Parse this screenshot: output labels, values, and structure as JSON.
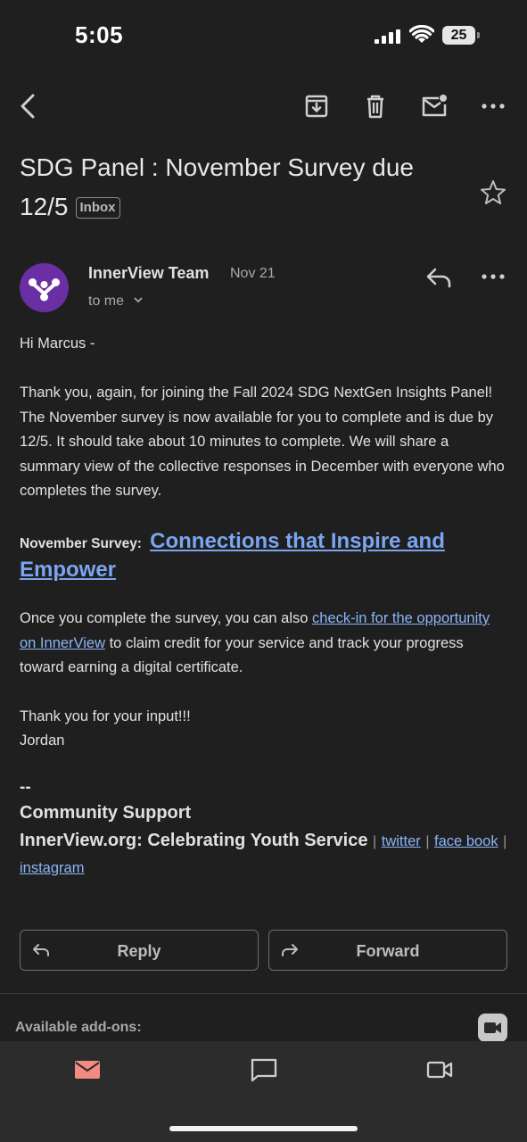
{
  "status_bar": {
    "time": "5:05",
    "battery": "25"
  },
  "toolbar": {
    "back_icon": "chevron-left-icon",
    "archive_icon": "archive-icon",
    "delete_icon": "trash-icon",
    "unread_icon": "mark-unread-icon",
    "more_icon": "more-horizontal-icon"
  },
  "email": {
    "subject": "SDG Panel : November Survey due 12/5",
    "label": "Inbox",
    "sender": "InnerView Team",
    "date": "Nov 21",
    "recipient": "to me",
    "greeting": "Hi Marcus -",
    "paragraph1": "Thank you, again, for joining the Fall 2024 SDG NextGen Insights Panel! The November survey is now available for you to complete and is due by 12/5. It should take about 10 minutes to complete. We will share a summary view of the collective responses in December with everyone who completes the survey.",
    "survey_label": "November Survey:",
    "survey_link": "Connections that Inspire and Empower",
    "paragraph2_before": "Once you complete the survey, you can also ",
    "paragraph2_link": "check-in for the opportunity on InnerView",
    "paragraph2_after": " to claim credit for your service and track your progress toward earning a digital certificate.",
    "closing": "Thank you for your input!!!",
    "signoff": "Jordan",
    "sig_dash": "--",
    "sig_line1": "Community Support",
    "sig_line2": "InnerView.org: Celebrating Youth Service",
    "sig_sep": "|",
    "sig_link_twitter": "twitter",
    "sig_link_facebook": "face book",
    "sig_link_instagram": "instagram"
  },
  "actions": {
    "reply": "Reply",
    "forward": "Forward"
  },
  "addons": {
    "label": "Available add-ons:"
  },
  "bottom_nav": {
    "mail_icon": "mail-icon",
    "chat_icon": "chat-icon",
    "meet_icon": "video-icon",
    "active_color": "#f28b82"
  },
  "colors": {
    "link": "#8ab4f8",
    "avatar": "#6a2fa3",
    "background": "#1f1f1f"
  }
}
